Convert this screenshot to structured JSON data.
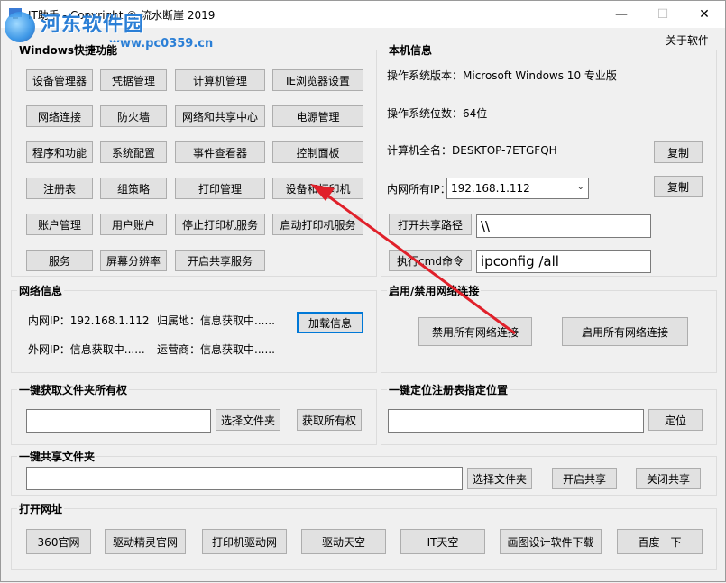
{
  "window": {
    "title": "IT助手 - Copyright © 流水断崖 2019",
    "about": "关于软件",
    "watermark_title": "河东软件园",
    "watermark_url": "www.pc0359.cn"
  },
  "windows_shortcuts": {
    "title": "Windows快捷功能",
    "buttons": [
      "设备管理器",
      "凭据管理",
      "计算机管理",
      "IE浏览器设置",
      "网络连接",
      "防火墙",
      "网络和共享中心",
      "电源管理",
      "程序和功能",
      "系统配置",
      "事件查看器",
      "控制面板",
      "注册表",
      "组策略",
      "打印管理",
      "设备和打印机",
      "账户管理",
      "用户账户",
      "停止打印机服务",
      "启动打印机服务",
      "服务",
      "屏幕分辨率",
      "开启共享服务"
    ]
  },
  "local_info": {
    "title": "本机信息",
    "os_version": "操作系统版本：Microsoft Windows 10 专业版",
    "os_bits": "操作系统位数：64位",
    "computer_name": "计算机全名：DESKTOP-7ETGFQH",
    "copy1": "复制",
    "lan_ip_label": "内网所有IP：",
    "lan_ip_value": "192.168.1.112",
    "copy2": "复制",
    "open_share_btn": "打开共享路径",
    "share_path_value": "\\\\",
    "run_cmd_btn": "执行cmd命令",
    "cmd_value": "ipconfig /all"
  },
  "network_info": {
    "title": "网络信息",
    "lan_ip": "内网IP：192.168.1.112",
    "location": "归属地：信息获取中......",
    "load_btn": "加载信息",
    "wan_ip": "外网IP：信息获取中......",
    "isp": "运营商：信息获取中......"
  },
  "net_toggle": {
    "title": "启用/禁用网络连接",
    "disable_btn": "禁用所有网络连接",
    "enable_btn": "启用所有网络连接"
  },
  "folder_owner": {
    "title": "一键获取文件夹所有权",
    "input_value": "",
    "select_btn": "选择文件夹",
    "take_btn": "获取所有权"
  },
  "registry": {
    "title": "一键定位注册表指定位置",
    "input_value": "",
    "locate_btn": "定位"
  },
  "share_folder": {
    "title": "一键共享文件夹",
    "input_value": "",
    "select_btn": "选择文件夹",
    "open_btn": "开启共享",
    "close_btn": "关闭共享"
  },
  "open_urls": {
    "title": "打开网址",
    "buttons": [
      "360官网",
      "驱动精灵官网",
      "打印机驱动网",
      "驱动天空",
      "IT天空",
      "画图设计软件下载",
      "百度一下"
    ]
  },
  "colors": {
    "arrow": "#e0202a",
    "accent": "#0078d7"
  }
}
